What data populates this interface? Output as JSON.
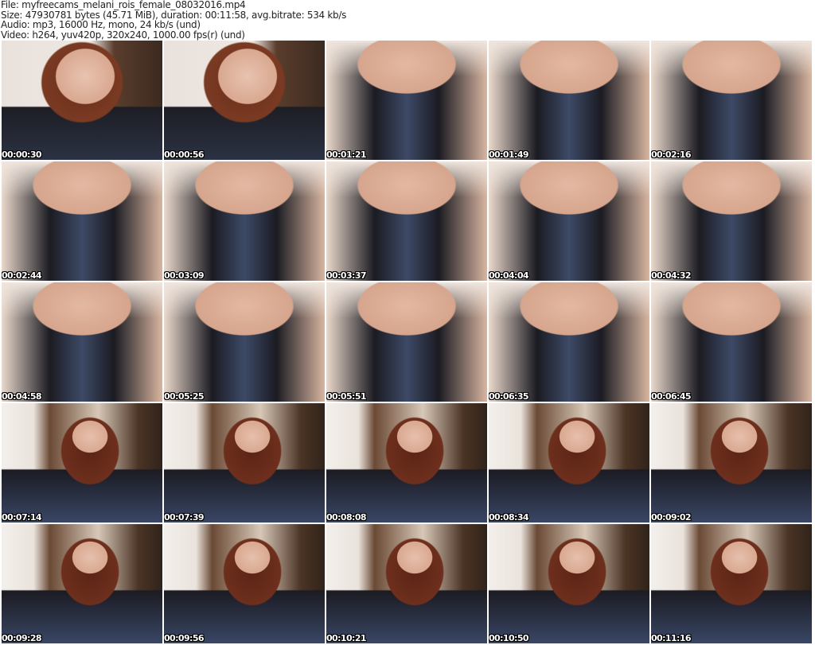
{
  "info": {
    "file": "File: myfreecams_melani_rois_female_08032016.mp4",
    "size": "Size: 47930781 bytes (45.71 MiB), duration: 00:11:58, avg.bitrate: 534 kb/s",
    "audio": "Audio: mp3, 16000 Hz, mono, 24 kb/s (und)",
    "video": "Video: h264, yuv420p, 320x240, 1000.00 fps(r) (und)"
  },
  "thumbnails": [
    {
      "timestamp": "00:00:30"
    },
    {
      "timestamp": "00:00:56"
    },
    {
      "timestamp": "00:01:21"
    },
    {
      "timestamp": "00:01:49"
    },
    {
      "timestamp": "00:02:16"
    },
    {
      "timestamp": "00:02:44"
    },
    {
      "timestamp": "00:03:09"
    },
    {
      "timestamp": "00:03:37"
    },
    {
      "timestamp": "00:04:04"
    },
    {
      "timestamp": "00:04:32"
    },
    {
      "timestamp": "00:04:58"
    },
    {
      "timestamp": "00:05:25"
    },
    {
      "timestamp": "00:05:51"
    },
    {
      "timestamp": "00:06:35"
    },
    {
      "timestamp": "00:06:45"
    },
    {
      "timestamp": "00:07:14"
    },
    {
      "timestamp": "00:07:39"
    },
    {
      "timestamp": "00:08:08"
    },
    {
      "timestamp": "00:08:34"
    },
    {
      "timestamp": "00:09:02"
    },
    {
      "timestamp": "00:09:28"
    },
    {
      "timestamp": "00:09:56"
    },
    {
      "timestamp": "00:10:21"
    },
    {
      "timestamp": "00:10:50"
    },
    {
      "timestamp": "00:11:16"
    }
  ]
}
